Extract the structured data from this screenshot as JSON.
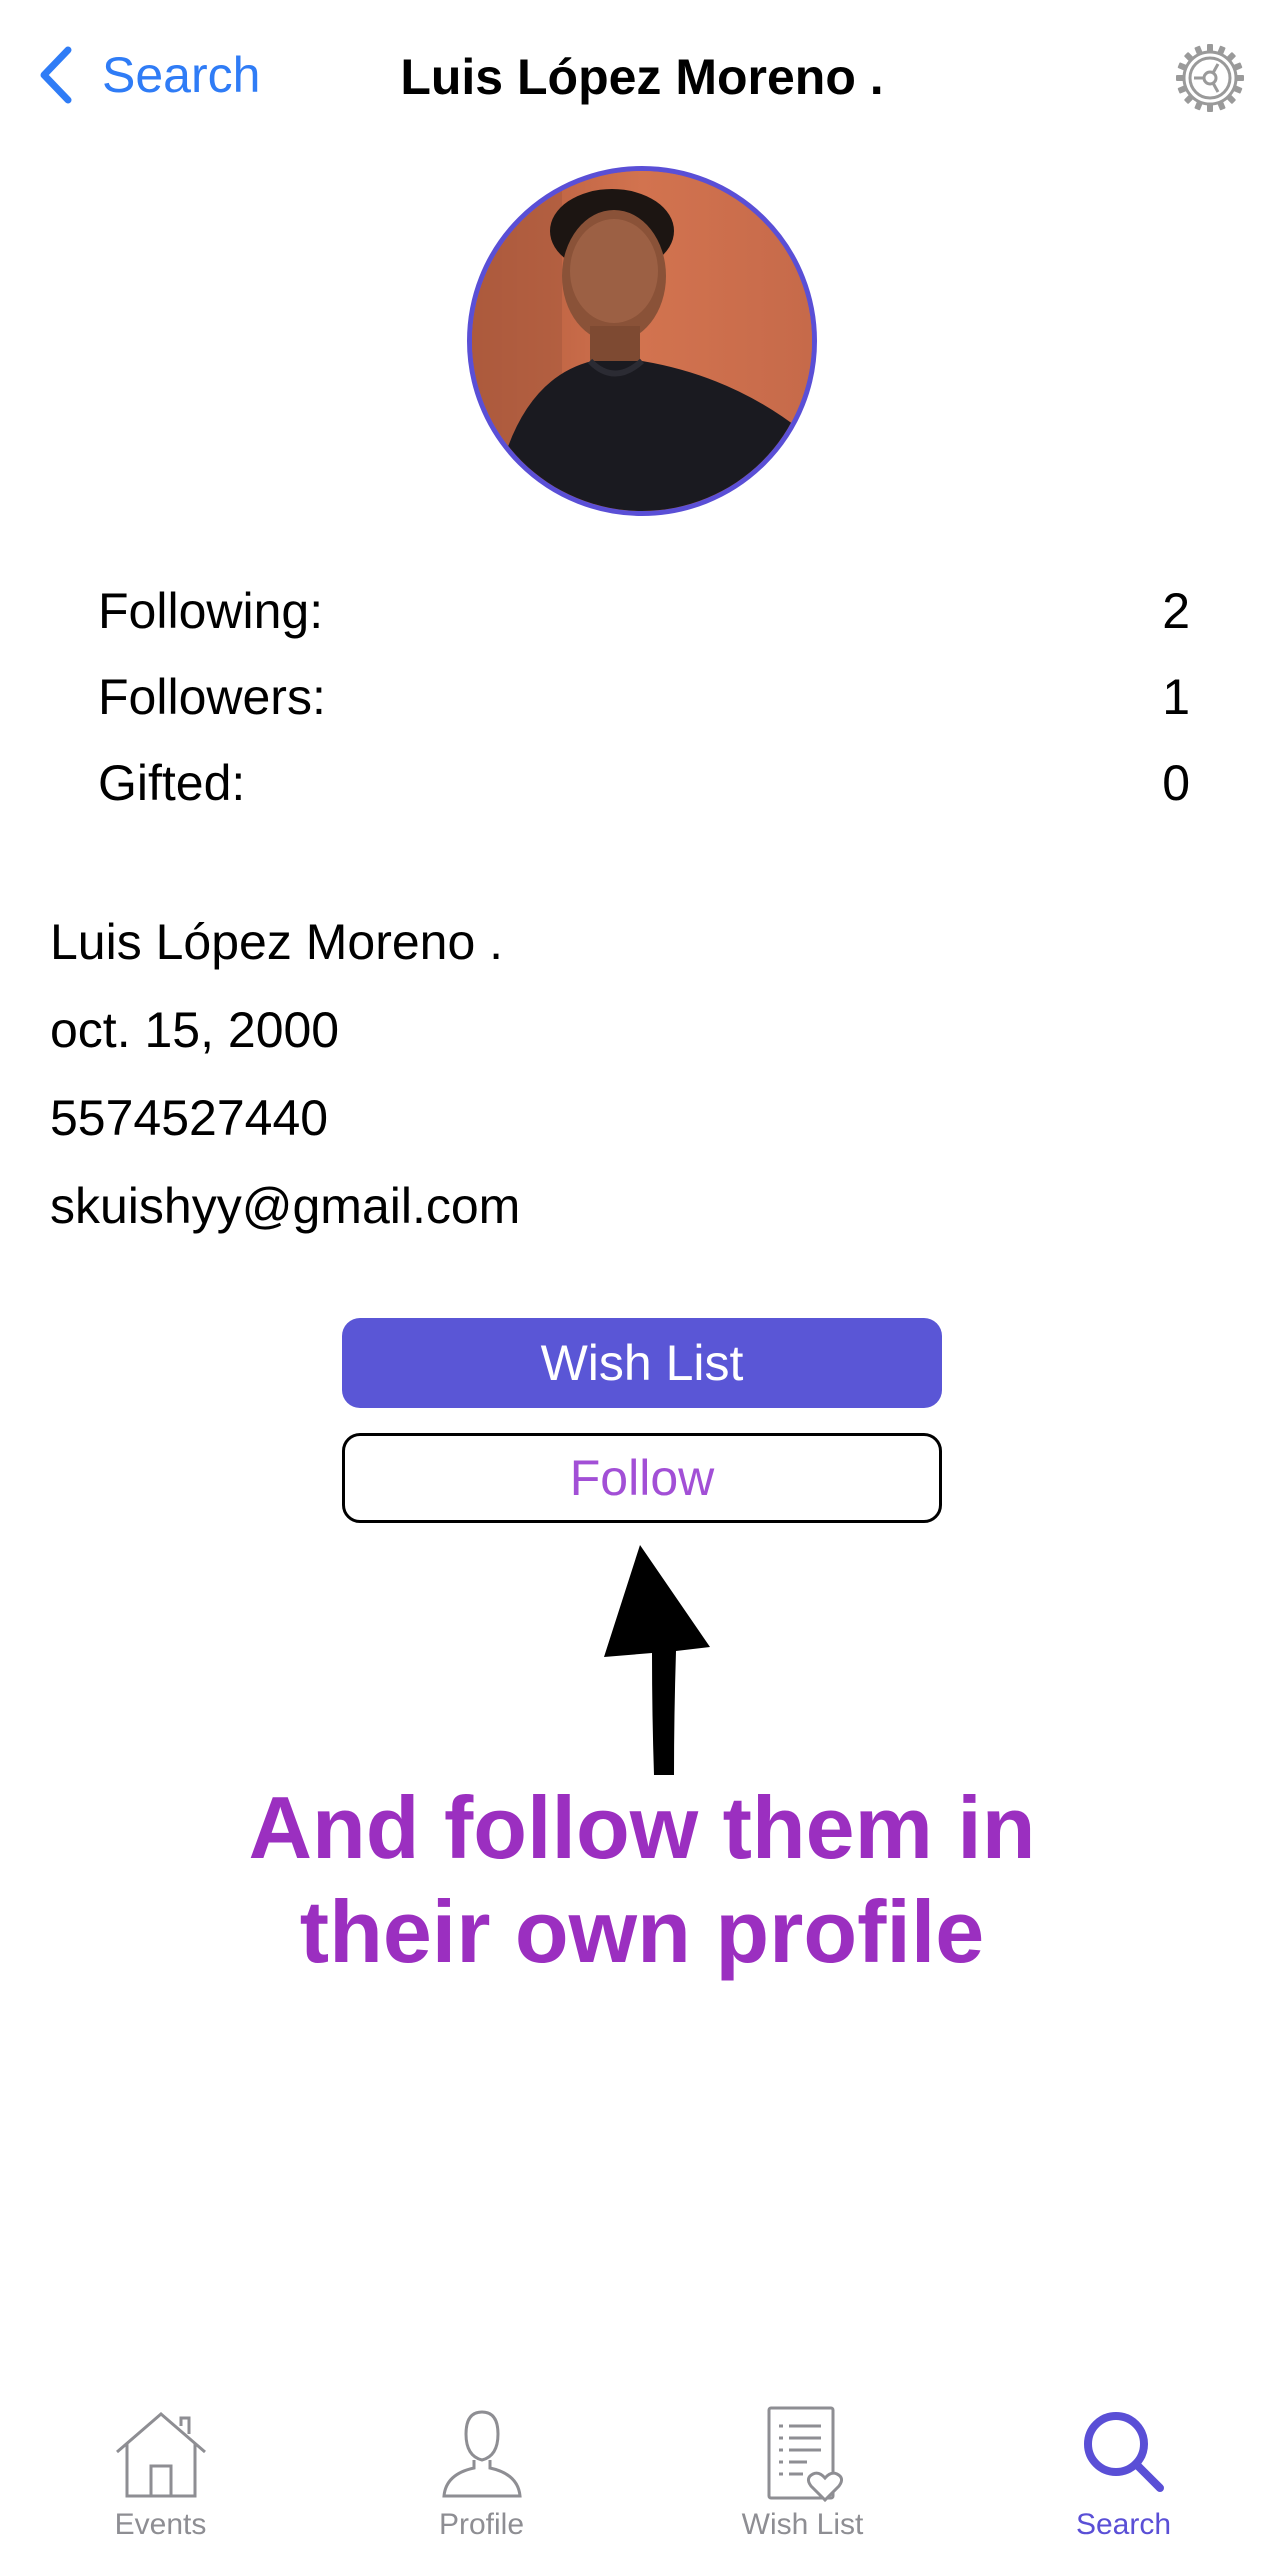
{
  "nav": {
    "back_label": "Search",
    "title": "Luis López Moreno ."
  },
  "stats": [
    {
      "label": "Following:",
      "value": "2"
    },
    {
      "label": "Followers:",
      "value": "1"
    },
    {
      "label": "Gifted:",
      "value": "0"
    }
  ],
  "info": {
    "name": "Luis López Moreno .",
    "birthday": "oct. 15, 2000",
    "phone": "5574527440",
    "email": "skuishyy@gmail.com"
  },
  "buttons": {
    "wish_list": "Wish List",
    "follow": "Follow"
  },
  "annotation": {
    "line1": "And follow them in",
    "line2": "their own profile"
  },
  "tabs": [
    {
      "label": "Events",
      "icon": "house-icon",
      "active": false
    },
    {
      "label": "Profile",
      "icon": "person-icon",
      "active": false
    },
    {
      "label": "Wish List",
      "icon": "list-heart-icon",
      "active": false
    },
    {
      "label": "Search",
      "icon": "search-icon",
      "active": true
    }
  ],
  "colors": {
    "accent": "#5a56d6",
    "link": "#2f7cf6",
    "follow_text": "#a24fd6",
    "annotation": "#9b2fc0",
    "inactive_tab": "#8e8e93"
  }
}
